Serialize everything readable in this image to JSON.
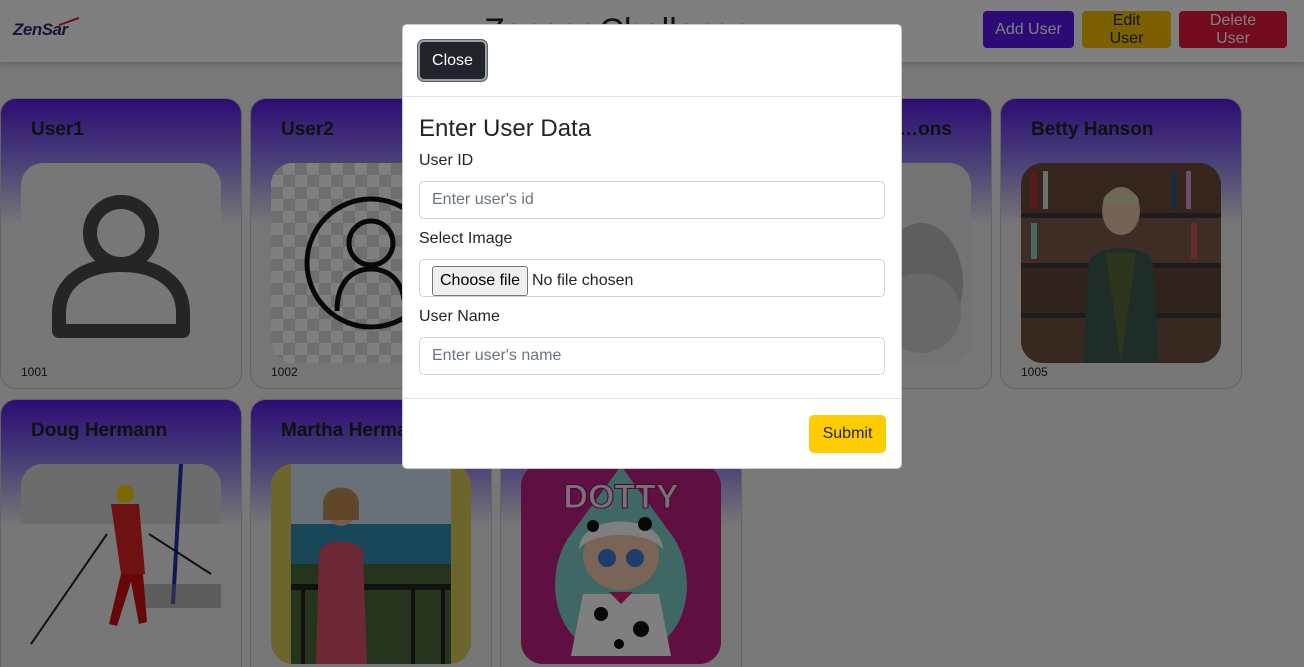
{
  "header": {
    "logo_text": "ZenSar",
    "title": "Zensar Challenge",
    "add_label": "Add User",
    "edit_label": "Edit User",
    "delete_label": "Delete User"
  },
  "cards": [
    {
      "name": "User1",
      "id": "1001",
      "image": "user-outline-icon"
    },
    {
      "name": "User2",
      "id": "1002",
      "image": "user-circle-icon"
    },
    {
      "name": "…ons",
      "id": "",
      "image": "bearded-man-photo"
    },
    {
      "name": "Betty Hanson",
      "id": "1005",
      "image": "woman-bookshelf-photo"
    },
    {
      "name": "Doug Hermann",
      "id": "",
      "image": "skier-photo"
    },
    {
      "name": "Martha Herma",
      "id": "",
      "image": "woman-balcony-photo"
    },
    {
      "name": "",
      "id": "",
      "image": "dotty-doll-photo",
      "photo_text": "DOTTY"
    }
  ],
  "modal": {
    "close_label": "Close",
    "title": "Enter User Data",
    "user_id_label": "User ID",
    "user_id_placeholder": "Enter user's id",
    "user_id_value": "",
    "image_label": "Select Image",
    "file_button_label": "Choose file",
    "file_status": "No file chosen",
    "user_name_label": "User Name",
    "user_name_placeholder": "Enter user's name",
    "user_name_value": "",
    "submit_label": "Submit"
  },
  "colors": {
    "add": "#5a17ee",
    "edit": "#f6c100",
    "delete": "#e3173a",
    "submit": "#ffcc00",
    "card_gradient_top": "#5a1ae6"
  }
}
